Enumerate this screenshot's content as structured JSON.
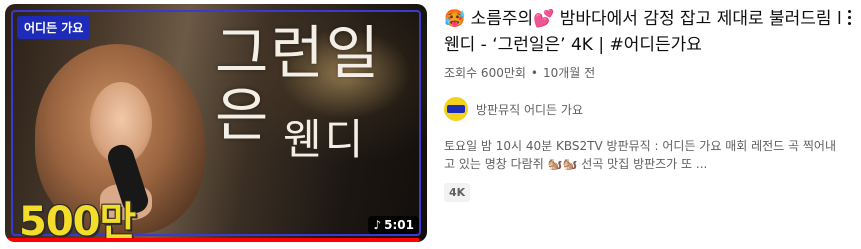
{
  "thumbnail": {
    "logo_text": "어디든 가요",
    "title_art": "그런일은",
    "name_art": "웬디",
    "views_badge": "500만",
    "duration": "5:01",
    "duration_icon": "music-note-icon",
    "progress_fraction": 0.98,
    "progress_color": "#ff0000"
  },
  "video": {
    "title_parts": [
      "소름주의",
      "밤바다에서 감정 잡고 제대로 불러드림 l 웬디 - ‘그런일은’ 4K | #어디든가요"
    ],
    "emoji_a": "🥵",
    "emoji_b": "💕",
    "views": "조회수 600만회",
    "separator": "•",
    "age": "10개월 전"
  },
  "channel": {
    "name": "방판뮤직 어디든 가요",
    "avatar_color": "#f2d21b"
  },
  "description": "토요일 밤 10시 40분 KBS2TV 방판뮤직 : 어디든 가요 매회 레전드 곡 찍어내고 있는 명창 다람쥐 🐿️🐿️ 선곡 맛집 방판즈가 또 ...",
  "badges": [
    "4K"
  ],
  "menu_icon": "more-vert-icon"
}
